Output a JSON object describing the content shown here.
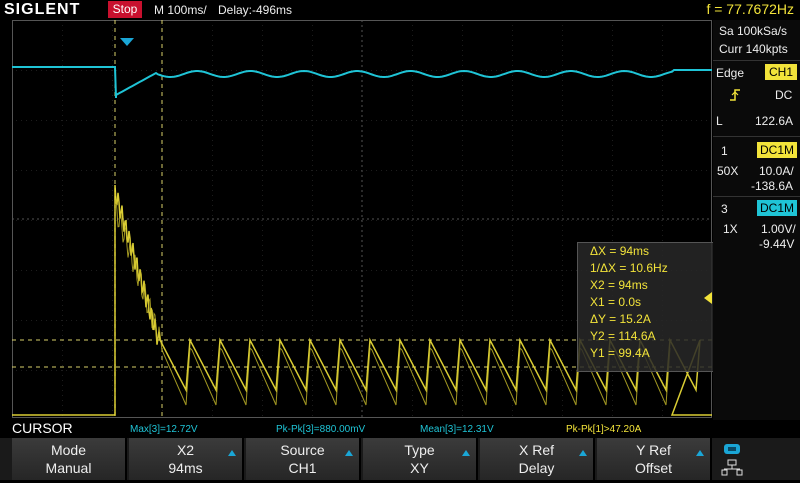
{
  "header": {
    "brand": "SIGLENT",
    "run_state": "Stop",
    "timebase": "M 100ms/",
    "delay": "Delay:-496ms",
    "frequency": "f = 77.7672Hz"
  },
  "acquisition": {
    "sample_rate": "Sa 100kSa/s",
    "memory": "Curr 140kpts"
  },
  "trigger": {
    "type": "Edge",
    "source": "CH1",
    "coupling": "DC",
    "level_prefix": "L",
    "level": "122.6A"
  },
  "channels": [
    {
      "id": "1",
      "coupling": "DC1M",
      "probe": "50X",
      "scale": "10.0A/",
      "offset": "-138.6A",
      "color": "#f2e33a"
    },
    {
      "id": "3",
      "coupling": "DC1M",
      "probe": "1X",
      "scale": "1.00V/",
      "offset": "-9.44V",
      "color": "#1fc4d6"
    }
  ],
  "cursor_readout": [
    "ΔX = 94ms",
    "1/ΔX = 10.6Hz",
    "X2 = 94ms",
    "X1 = 0.0s",
    "ΔY = 15.2A",
    "Y2 = 114.6A",
    "Y1 = 99.4A"
  ],
  "measurements": {
    "mode_label": "CURSOR",
    "max": "Max[3]=12.72V",
    "pkpk3": "Pk-Pk[3]=880.00mV",
    "mean": "Mean[3]=12.31V",
    "pkpk1": "Pk-Pk[1]>47.20A"
  },
  "softkeys": [
    {
      "title": "Mode",
      "value": "Manual",
      "arrow": false
    },
    {
      "title": "X2",
      "value": "94ms",
      "arrow": true
    },
    {
      "title": "Source",
      "value": "CH1",
      "arrow": true
    },
    {
      "title": "Type",
      "value": "XY",
      "arrow": true
    },
    {
      "title": "X Ref",
      "value": "Delay",
      "arrow": true
    },
    {
      "title": "Y Ref",
      "value": "Offset",
      "arrow": true
    }
  ],
  "colors": {
    "ch1_trace": "#f2e33a",
    "ch3_trace": "#1fc4d6",
    "grid": "#3a3a3a",
    "stop_badge": "#c8102e"
  },
  "icons": [
    "trigger-edge-rising-icon",
    "usb-icon",
    "network-icon"
  ]
}
